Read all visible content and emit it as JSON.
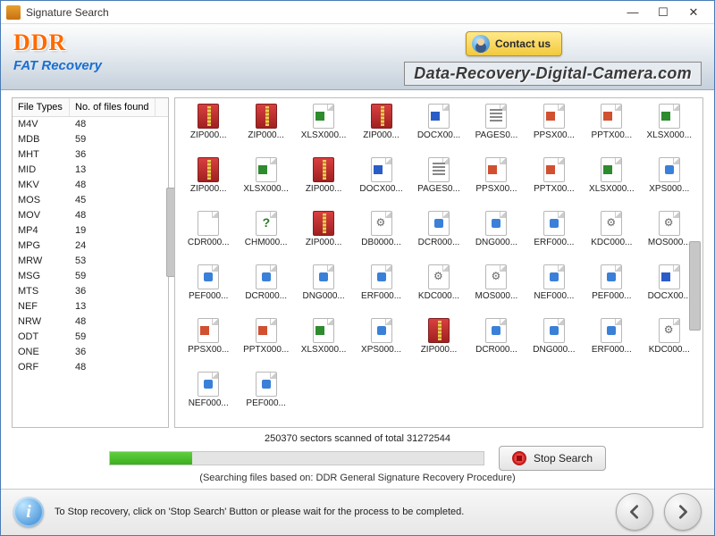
{
  "window": {
    "title": "Signature Search"
  },
  "brand": {
    "name": "DDR",
    "product": "FAT Recovery",
    "contact": "Contact us",
    "watermark": "Data-Recovery-Digital-Camera.com"
  },
  "file_types": {
    "col1": "File Types",
    "col2": "No. of files found",
    "rows": [
      {
        "t": "M4V",
        "n": "48"
      },
      {
        "t": "MDB",
        "n": "59"
      },
      {
        "t": "MHT",
        "n": "36"
      },
      {
        "t": "MID",
        "n": "13"
      },
      {
        "t": "MKV",
        "n": "48"
      },
      {
        "t": "MOS",
        "n": "45"
      },
      {
        "t": "MOV",
        "n": "48"
      },
      {
        "t": "MP4",
        "n": "19"
      },
      {
        "t": "MPG",
        "n": "24"
      },
      {
        "t": "MRW",
        "n": "53"
      },
      {
        "t": "MSG",
        "n": "59"
      },
      {
        "t": "MTS",
        "n": "36"
      },
      {
        "t": "NEF",
        "n": "13"
      },
      {
        "t": "NRW",
        "n": "48"
      },
      {
        "t": "ODT",
        "n": "59"
      },
      {
        "t": "ONE",
        "n": "36"
      },
      {
        "t": "ORF",
        "n": "48"
      }
    ]
  },
  "files": [
    {
      "n": "ZIP000...",
      "k": "zip"
    },
    {
      "n": "ZIP000...",
      "k": "zip"
    },
    {
      "n": "XLSX000...",
      "k": "xls"
    },
    {
      "n": "ZIP000...",
      "k": "zip"
    },
    {
      "n": "DOCX00...",
      "k": "doc"
    },
    {
      "n": "PAGES0...",
      "k": "page"
    },
    {
      "n": "PPSX00...",
      "k": "ppt"
    },
    {
      "n": "PPTX00...",
      "k": "ppt"
    },
    {
      "n": "XLSX000...",
      "k": "xls"
    },
    {
      "n": "ZIP000...",
      "k": "zip"
    },
    {
      "n": "XLSX000...",
      "k": "xls"
    },
    {
      "n": "ZIP000...",
      "k": "zip"
    },
    {
      "n": "DOCX00...",
      "k": "doc"
    },
    {
      "n": "PAGES0...",
      "k": "page"
    },
    {
      "n": "PPSX00...",
      "k": "ppt"
    },
    {
      "n": "PPTX00...",
      "k": "ppt"
    },
    {
      "n": "XLSX000...",
      "k": "xls"
    },
    {
      "n": "XPS000...",
      "k": "blue"
    },
    {
      "n": "CDR000...",
      "k": "plain"
    },
    {
      "n": "CHM000...",
      "k": "chm"
    },
    {
      "n": "ZIP000...",
      "k": "zip"
    },
    {
      "n": "DB0000...",
      "k": "gear"
    },
    {
      "n": "DCR000...",
      "k": "blue"
    },
    {
      "n": "DNG000...",
      "k": "blue"
    },
    {
      "n": "ERF000...",
      "k": "blue"
    },
    {
      "n": "KDC000...",
      "k": "gear"
    },
    {
      "n": "MOS000...",
      "k": "gear"
    },
    {
      "n": "PEF000...",
      "k": "blue"
    },
    {
      "n": "DCR000...",
      "k": "blue"
    },
    {
      "n": "DNG000...",
      "k": "blue"
    },
    {
      "n": "ERF000...",
      "k": "blue"
    },
    {
      "n": "KDC000...",
      "k": "gear"
    },
    {
      "n": "MOS000...",
      "k": "gear"
    },
    {
      "n": "NEF000...",
      "k": "blue"
    },
    {
      "n": "PEF000...",
      "k": "blue"
    },
    {
      "n": "DOCX00...",
      "k": "doc"
    },
    {
      "n": "PPSX00...",
      "k": "ppt"
    },
    {
      "n": "PPTX000...",
      "k": "ppt"
    },
    {
      "n": "XLSX000...",
      "k": "xls"
    },
    {
      "n": "XPS000...",
      "k": "blue"
    },
    {
      "n": "ZIP000...",
      "k": "zip"
    },
    {
      "n": "DCR000...",
      "k": "blue"
    },
    {
      "n": "DNG000...",
      "k": "blue"
    },
    {
      "n": "ERF000...",
      "k": "blue"
    },
    {
      "n": "KDC000...",
      "k": "gear"
    },
    {
      "n": "NEF000...",
      "k": "blue"
    },
    {
      "n": "PEF000...",
      "k": "blue"
    }
  ],
  "progress": {
    "status": "250370 sectors scanned of total 31272544",
    "percent": 22,
    "note": "(Searching files based on:  DDR General Signature Recovery Procedure)",
    "stop_label": "Stop Search"
  },
  "footer": {
    "tip": "To Stop recovery, click on 'Stop Search' Button or please wait for the process to be completed."
  }
}
